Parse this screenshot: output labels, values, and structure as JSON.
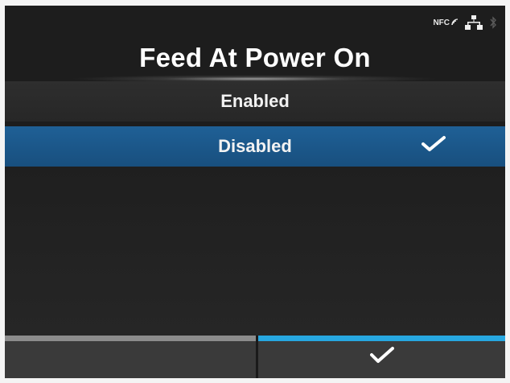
{
  "status": {
    "nfc_label": "NFC",
    "icons": [
      "nfc-icon",
      "network-icon",
      "bluetooth-icon"
    ]
  },
  "screen": {
    "title": "Feed At Power On"
  },
  "options": [
    {
      "label": "Enabled",
      "selected": false
    },
    {
      "label": "Disabled",
      "selected": true
    }
  ],
  "softkeys": {
    "left": {
      "label": "",
      "color": "#8c8c8c"
    },
    "right": {
      "icon": "checkmark-icon",
      "color": "#27a7e0"
    }
  },
  "colors": {
    "selected_row": "#1f6096",
    "background": "#1d1d1d",
    "accent": "#27a7e0"
  }
}
